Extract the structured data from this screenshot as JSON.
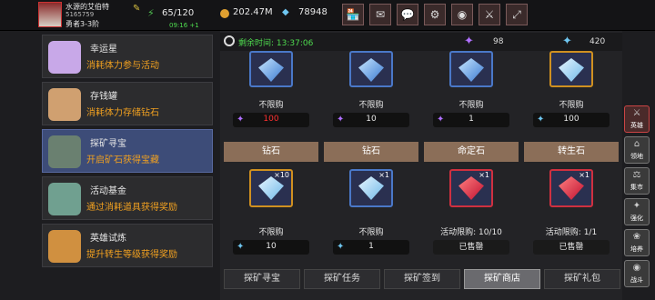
{
  "player": {
    "name": "水源的艾伯特",
    "id": "5165759",
    "rank": "勇者3-3阶",
    "stamina": "65/120",
    "timer": "09:16 +1",
    "coins": "202.47M",
    "diamonds": "78948"
  },
  "toolbar": [
    {
      "icon": "shop-icon",
      "glyph": "🏪"
    },
    {
      "icon": "mail-icon",
      "glyph": "✉"
    },
    {
      "icon": "chat-icon",
      "glyph": "💬"
    },
    {
      "icon": "gear-icon",
      "glyph": "⚙"
    },
    {
      "icon": "color-wheel-icon",
      "glyph": "◉"
    },
    {
      "icon": "tool-icon",
      "glyph": "⚔"
    },
    {
      "icon": "fullscreen-icon",
      "glyph": "⤢"
    }
  ],
  "menu": [
    {
      "title": "幸运星",
      "desc": "消耗体力参与活动",
      "color": "#c8a8e8",
      "selected": false
    },
    {
      "title": "存钱罐",
      "desc": "消耗体力存储钻石",
      "color": "#d0a070",
      "selected": false
    },
    {
      "title": "探矿寻宝",
      "desc": "开启矿石获得宝藏",
      "color": "#6a8070",
      "selected": true
    },
    {
      "title": "活动基金",
      "desc": "通过消耗道具获得奖励",
      "color": "#70a090",
      "selected": false
    },
    {
      "title": "英雄试炼",
      "desc": "提升转生等级获得奖励",
      "color": "#d09040",
      "selected": false
    }
  ],
  "timebar": {
    "label": "剩余时间: 13:37:06",
    "purple_crystal": "98",
    "blue_crystal": "420"
  },
  "row1": [
    {
      "border": "blue",
      "gem": "blueg",
      "limit": "不限购",
      "price_icon": "purple",
      "price": "100",
      "price_red": true
    },
    {
      "border": "blue",
      "gem": "blueg",
      "limit": "不限购",
      "price_icon": "purple",
      "price": "10",
      "price_red": false
    },
    {
      "border": "blue",
      "gem": "blueg",
      "limit": "不限购",
      "price_icon": "purple",
      "price": "1",
      "price_red": false
    },
    {
      "border": "gold",
      "gem": "",
      "limit": "不限购",
      "price_icon": "blue",
      "price": "100",
      "price_red": false
    }
  ],
  "row2": [
    {
      "name": "钻石",
      "border": "gold",
      "gem": "",
      "qty": "×10",
      "limit": "不限购",
      "type": "price",
      "price": "10"
    },
    {
      "name": "钻石",
      "border": "blue",
      "gem": "",
      "qty": "×1",
      "limit": "不限购",
      "type": "price",
      "price": "1"
    },
    {
      "name": "命定石",
      "border": "red",
      "gem": "red",
      "qty": "×1",
      "limit": "活动限购: 10/10",
      "type": "sold",
      "price": "已售罄"
    },
    {
      "name": "转生石",
      "border": "red",
      "gem": "red",
      "qty": "×1",
      "limit": "活动限购: 1/1",
      "type": "sold",
      "price": "已售罄"
    }
  ],
  "tabs": [
    {
      "label": "探矿寻宝",
      "active": false
    },
    {
      "label": "探矿任务",
      "active": false
    },
    {
      "label": "探矿签到",
      "active": false
    },
    {
      "label": "探矿商店",
      "active": true
    },
    {
      "label": "探矿礼包",
      "active": false
    }
  ],
  "rightnav": [
    {
      "label": "英雄",
      "icon": "hero-icon",
      "glyph": "⚔"
    },
    {
      "label": "领地",
      "icon": "territory-icon",
      "glyph": "⌂"
    },
    {
      "label": "集市",
      "icon": "market-icon",
      "glyph": "⚖"
    },
    {
      "label": "强化",
      "icon": "enhance-icon",
      "glyph": "✦"
    },
    {
      "label": "培养",
      "icon": "train-icon",
      "glyph": "❀"
    },
    {
      "label": "战斗",
      "icon": "battle-icon",
      "glyph": "◉"
    }
  ]
}
